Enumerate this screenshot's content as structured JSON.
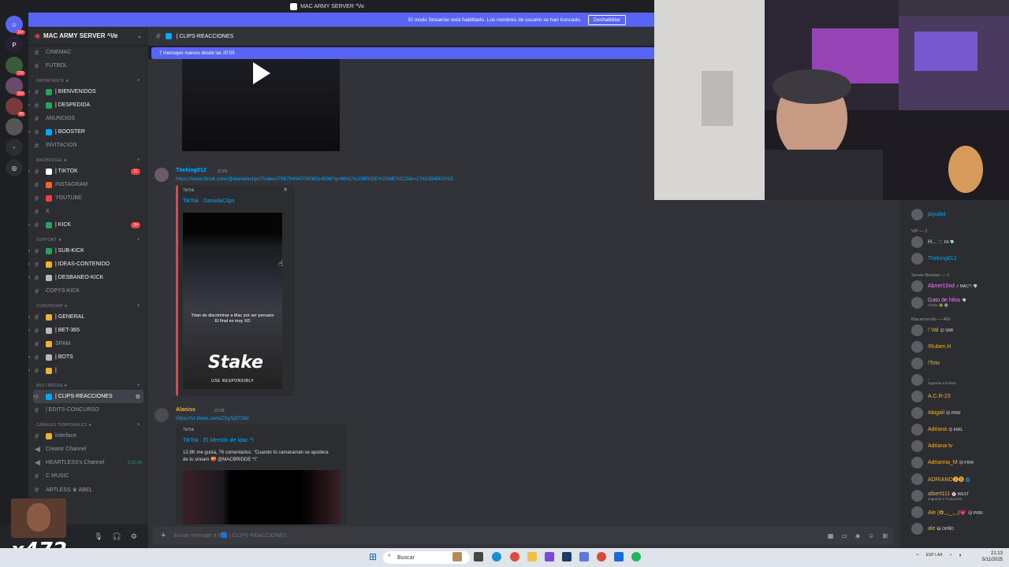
{
  "window": {
    "title": "MAC ARMY SERVER ^\\/ɐ"
  },
  "banner": {
    "text": "El modo Streamer está habilitado. Los nombres de usuario se han truncado.",
    "button": "Deshabilitar"
  },
  "server": {
    "name": "MAC ARMY SERVER ^\\/ɐ"
  },
  "rail": {
    "badges": [
      "1k+",
      "",
      "126",
      "162",
      "89"
    ]
  },
  "channels": [
    {
      "type": "ch",
      "label": "CINEMAC",
      "dim": true
    },
    {
      "type": "ch",
      "label": "FUTBOL",
      "dim": true
    },
    {
      "type": "cat",
      "label": "IMPORTANTE ★"
    },
    {
      "type": "ch",
      "label": "| BIENVENIDOS",
      "dot": "#23a55a"
    },
    {
      "type": "ch",
      "label": "| DESPEDIDA",
      "dot": "#23a55a"
    },
    {
      "type": "ch",
      "label": "ANUNCIOS",
      "dim": true
    },
    {
      "type": "ch",
      "label": "| BOOSTER",
      "dot": "#00a8fc"
    },
    {
      "type": "ch",
      "label": "INVITACION",
      "dim": true
    },
    {
      "type": "cat",
      "label": "MACBRIDGE ★"
    },
    {
      "type": "ch",
      "label": "| TIKTOK",
      "dot": "#ffffff",
      "badge": "21"
    },
    {
      "type": "ch",
      "label": "INSTAGRAM",
      "dim": true,
      "dot": "#f26522"
    },
    {
      "type": "ch",
      "label": "YOUTUBE",
      "dim": true,
      "dot": "#f23f43"
    },
    {
      "type": "ch",
      "label": "X",
      "dim": true
    },
    {
      "type": "ch",
      "label": "| KICK",
      "dot": "#23a55a",
      "badge": "34"
    },
    {
      "type": "cat",
      "label": "SUPPORT ★"
    },
    {
      "type": "ch",
      "label": "| SUB-KICK",
      "dot": "#23a55a"
    },
    {
      "type": "ch",
      "label": "| IDEAS-CONTENIDO",
      "dot": "#f0b232"
    },
    {
      "type": "ch",
      "label": "| DESBANEO-KICK",
      "dot": "#b5bac1"
    },
    {
      "type": "ch",
      "label": "COPYS-KICK",
      "dim": true
    },
    {
      "type": "cat",
      "label": "COMUNIDAD ★"
    },
    {
      "type": "ch",
      "label": "| GENERAL",
      "dot": "#f0b232"
    },
    {
      "type": "ch",
      "label": "| BET-365",
      "dot": "#b5bac1"
    },
    {
      "type": "ch",
      "label": "SPAM",
      "dim": true,
      "dot": "#f0b232"
    },
    {
      "type": "ch",
      "label": "| BOTS",
      "dot": "#b5bac1"
    },
    {
      "type": "ch",
      "label": "|",
      "dot": "#f0b232"
    },
    {
      "type": "cat",
      "label": "MULTIMEDIA ★"
    },
    {
      "type": "ch",
      "label": "| CLIPS-REACCIONES",
      "active": true,
      "dot": "#00a8fc"
    },
    {
      "type": "ch",
      "label": "| EDITS-CONCURSO",
      "dim": true
    },
    {
      "type": "cat",
      "label": "CANALES TEMPORALES ★"
    },
    {
      "type": "ch",
      "label": "interface",
      "dim": true,
      "dot": "#f0b232"
    },
    {
      "type": "ch",
      "label": "Creator Channel",
      "dim": true,
      "voice": true
    },
    {
      "type": "ch",
      "label": "HEARTLESS's Channel",
      "dim": true,
      "voice": true,
      "timer": "3:32:36"
    },
    {
      "type": "ch",
      "label": "C MUSIC",
      "dim": true
    },
    {
      "type": "ch",
      "label": "ARTLESS ♛ ABEL",
      "dim": true
    }
  ],
  "overlay": {
    "count": "x472"
  },
  "chat": {
    "channel": "| CLIPS-REACCIONES",
    "new_messages": "7 mensajes nuevos desde las 20:55",
    "msg1": {
      "user": "Theking812",
      "time": "21:01",
      "link": "https://www.tiktok.com/@danielaclips7/video/7567949470856514836?q=MAC%20BRIDE%20MEXICO&t=1762394502015",
      "provider": "TikTok",
      "title": "TikTok · DanielaClips",
      "caption": "Trtan de discriminar a Mac por ser peruano\nEl final es muy XD",
      "brand": "Stake",
      "brand_sub": "USE RESPONSIBLY"
    },
    "msg2": {
      "user": "Alaniss",
      "time": "21:03",
      "link": "https://vt.tiktok.com/ZSySjSTS8/",
      "provider": "TikTok",
      "title": "TikTok · El Mentón de Mac ^\\",
      "desc": "12.8K me gusta, 76 comentarios. \"Cuando tú camaraman se apodera de tu stream 🍑 @MACBRIDDE ^\\\""
    },
    "input_placeholder": "Enviar mensaje a #🟦 | CLIPS-REACCIONES"
  },
  "members": [
    {
      "kind": "m",
      "name": "piyudol",
      "color": "#00a8fc"
    },
    {
      "kind": "cat",
      "label": "VIP — 2"
    },
    {
      "kind": "m",
      "name": "H...",
      "color": "#dbdee1",
      "tag": "🎵 FA 💎"
    },
    {
      "kind": "m",
      "name": "Theking812",
      "color": "#00a8fc"
    },
    {
      "kind": "cat",
      "label": "Server Booster — 2"
    },
    {
      "kind": "m",
      "name": "Abner10xd",
      "color": "#f47fff",
      "tag": "⚡ MAC^\\ 💎"
    },
    {
      "kind": "m",
      "name": "Gato de hilos",
      "color": "#f47fff",
      "sub": "chicas 🐝 ⚙️",
      "tag": "💎"
    },
    {
      "kind": "cat",
      "label": "Macarroncito — 466"
    },
    {
      "kind": "m",
      "name": "! Val",
      "color": "#f0b232",
      "tag": "😊 SAB"
    },
    {
      "kind": "m",
      "name": "!Ruben.H",
      "color": "#f0b232"
    },
    {
      "kind": "m",
      "name": "!Toto",
      "color": "#f0b232"
    },
    {
      "kind": "m",
      "name": ".",
      "color": "#f0b232",
      "sub": "Jugando a Roblox"
    },
    {
      "kind": "m",
      "name": "A.C.R-23",
      "color": "#f0b232"
    },
    {
      "kind": "m",
      "name": "Abigail",
      "color": "#f0b232",
      "tag": "🐱 PIRR"
    },
    {
      "kind": "m",
      "name": "Adriana",
      "color": "#f0b232",
      "tag": "😊 EMIL"
    },
    {
      "kind": "m",
      "name": "Adriana tv",
      "color": "#f0b232"
    },
    {
      "kind": "m",
      "name": "Adrianna_M",
      "color": "#f0b232",
      "tag": "🐱 PIRR"
    },
    {
      "kind": "m",
      "name": "ADRIANO🅘🅢",
      "color": "#f0b232",
      "tag": "🌐"
    },
    {
      "kind": "m",
      "name": "albert111",
      "color": "#f0b232",
      "sub": "Jugando a TLauncher",
      "tag": "🌸 WEST"
    },
    {
      "kind": "m",
      "name": "Ale (✿◡‿◡)💗",
      "color": "#f0b232",
      "tag": "🐱 PIRR"
    },
    {
      "kind": "m",
      "name": "ale",
      "color": "#f0b232",
      "tag": "😺 OHÑO"
    }
  ],
  "taskbar": {
    "search": "Buscar",
    "time": "21:13",
    "date": "5/11/2025",
    "lang": "ESP LAA"
  }
}
